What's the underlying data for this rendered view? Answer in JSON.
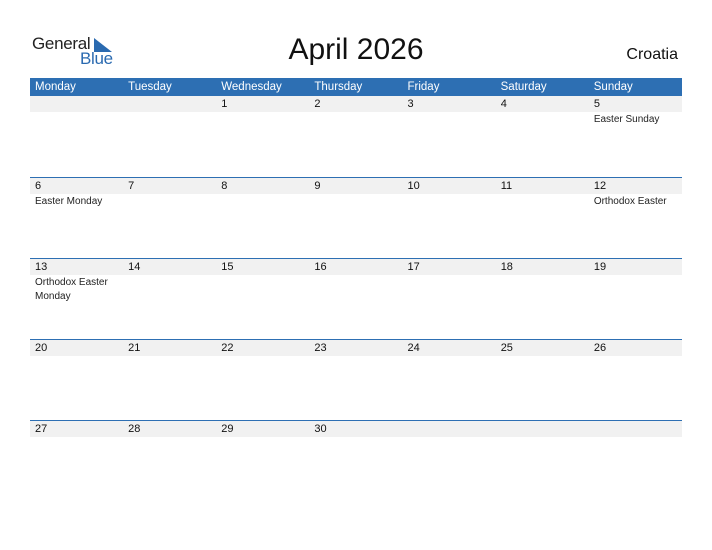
{
  "logo": {
    "line1": "General",
    "line2": "Blue",
    "accent_color": "#2a6ab0"
  },
  "title": "April 2026",
  "country": "Croatia",
  "header_color": "#2d6fb3",
  "weekdays": [
    "Monday",
    "Tuesday",
    "Wednesday",
    "Thursday",
    "Friday",
    "Saturday",
    "Sunday"
  ],
  "weeks": [
    {
      "days": [
        {
          "num": "",
          "holiday": ""
        },
        {
          "num": "",
          "holiday": ""
        },
        {
          "num": "1",
          "holiday": ""
        },
        {
          "num": "2",
          "holiday": ""
        },
        {
          "num": "3",
          "holiday": ""
        },
        {
          "num": "4",
          "holiday": ""
        },
        {
          "num": "5",
          "holiday": "Easter Sunday"
        }
      ]
    },
    {
      "days": [
        {
          "num": "6",
          "holiday": "Easter Monday"
        },
        {
          "num": "7",
          "holiday": ""
        },
        {
          "num": "8",
          "holiday": ""
        },
        {
          "num": "9",
          "holiday": ""
        },
        {
          "num": "10",
          "holiday": ""
        },
        {
          "num": "11",
          "holiday": ""
        },
        {
          "num": "12",
          "holiday": "Orthodox Easter"
        }
      ]
    },
    {
      "days": [
        {
          "num": "13",
          "holiday": "Orthodox Easter Monday"
        },
        {
          "num": "14",
          "holiday": ""
        },
        {
          "num": "15",
          "holiday": ""
        },
        {
          "num": "16",
          "holiday": ""
        },
        {
          "num": "17",
          "holiday": ""
        },
        {
          "num": "18",
          "holiday": ""
        },
        {
          "num": "19",
          "holiday": ""
        }
      ]
    },
    {
      "days": [
        {
          "num": "20",
          "holiday": ""
        },
        {
          "num": "21",
          "holiday": ""
        },
        {
          "num": "22",
          "holiday": ""
        },
        {
          "num": "23",
          "holiday": ""
        },
        {
          "num": "24",
          "holiday": ""
        },
        {
          "num": "25",
          "holiday": ""
        },
        {
          "num": "26",
          "holiday": ""
        }
      ]
    },
    {
      "days": [
        {
          "num": "27",
          "holiday": ""
        },
        {
          "num": "28",
          "holiday": ""
        },
        {
          "num": "29",
          "holiday": ""
        },
        {
          "num": "30",
          "holiday": ""
        },
        {
          "num": "",
          "holiday": ""
        },
        {
          "num": "",
          "holiday": ""
        },
        {
          "num": "",
          "holiday": ""
        }
      ]
    }
  ]
}
